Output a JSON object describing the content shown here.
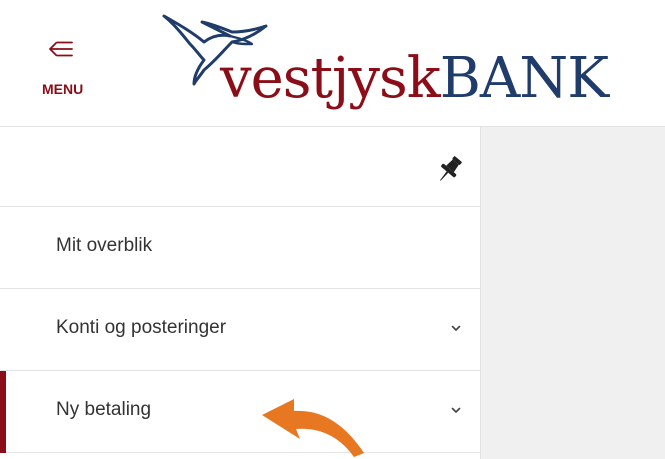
{
  "header": {
    "menu_label": "MENU",
    "logo": {
      "prefix": "vestjysk",
      "suffix": "BANK"
    }
  },
  "sidebar": {
    "pin_icon": "pin-icon",
    "items": [
      {
        "label": "Mit overblik",
        "expandable": false,
        "active": false
      },
      {
        "label": "Konti og posteringer",
        "expandable": true,
        "active": false
      },
      {
        "label": "Ny betaling",
        "expandable": true,
        "active": true
      }
    ]
  },
  "colors": {
    "brand_red": "#8b0d18",
    "brand_blue": "#1f3c6b",
    "annotation_orange": "#e87722",
    "content_bg": "#f0f0f0"
  }
}
